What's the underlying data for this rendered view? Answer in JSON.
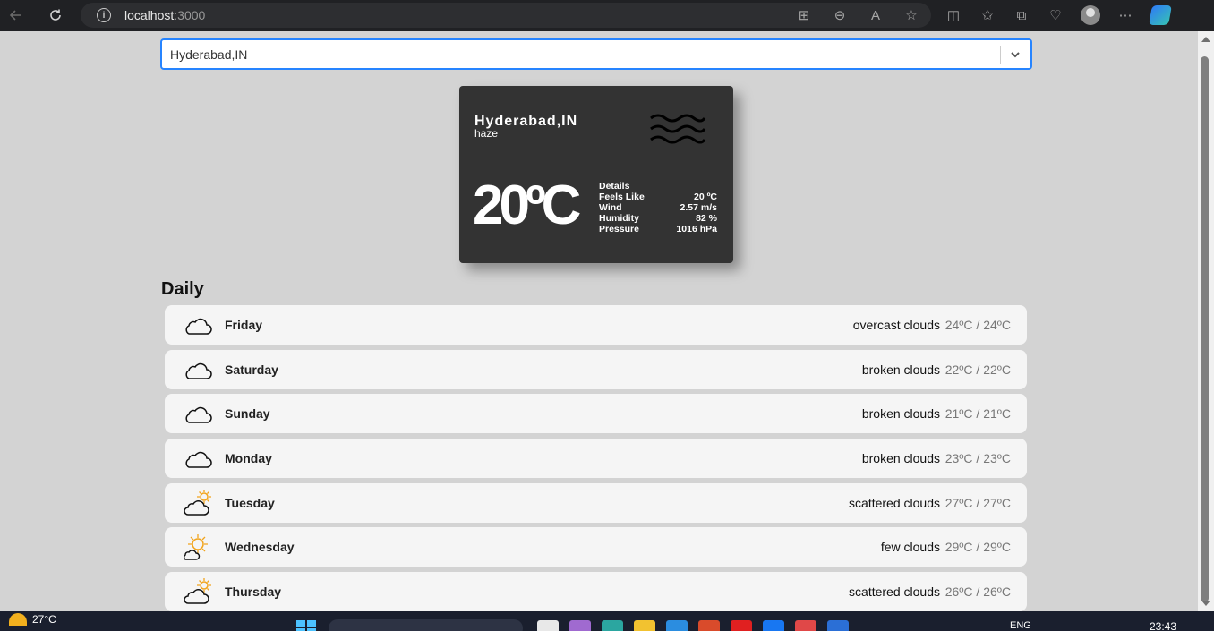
{
  "browser": {
    "url_host": "localhost",
    "url_port": ":3000"
  },
  "city_select": {
    "value": "Hyderabad,IN"
  },
  "current": {
    "city": "Hyderabad,IN",
    "description": "haze",
    "icon": "haze-icon",
    "temperature": "20ºC",
    "details_title": "Details",
    "details": [
      {
        "label": "Feels Like",
        "value": "20 ºC"
      },
      {
        "label": "Wind",
        "value": "2.57 m/s"
      },
      {
        "label": "Humidity",
        "value": "82 %"
      },
      {
        "label": "Pressure",
        "value": "1016 hPa"
      }
    ]
  },
  "daily": {
    "title": "Daily",
    "days": [
      {
        "day": "Friday",
        "description": "overcast clouds",
        "temp": "24ºC / 24ºC",
        "icon": "cloud-icon"
      },
      {
        "day": "Saturday",
        "description": "broken clouds",
        "temp": "22ºC / 22ºC",
        "icon": "cloud-icon"
      },
      {
        "day": "Sunday",
        "description": "broken clouds",
        "temp": "21ºC / 21ºC",
        "icon": "cloud-icon"
      },
      {
        "day": "Monday",
        "description": "broken clouds",
        "temp": "23ºC / 23ºC",
        "icon": "cloud-icon"
      },
      {
        "day": "Tuesday",
        "description": "scattered clouds",
        "temp": "27ºC / 27ºC",
        "icon": "cloud-sun-icon"
      },
      {
        "day": "Wednesday",
        "description": "few clouds",
        "temp": "29ºC / 29ºC",
        "icon": "sun-cloud-icon"
      },
      {
        "day": "Thursday",
        "description": "scattered clouds",
        "temp": "26ºC / 26ºC",
        "icon": "cloud-sun-icon"
      }
    ]
  },
  "taskbar": {
    "weather_temp": "27°C",
    "language": "ENG",
    "time": "23:43"
  },
  "colors": {
    "page_bg": "#d3d3d3",
    "card_bg": "#333333",
    "row_bg": "#f5f5f5",
    "select_border": "#2684ff",
    "sun": "#f2a51e"
  }
}
